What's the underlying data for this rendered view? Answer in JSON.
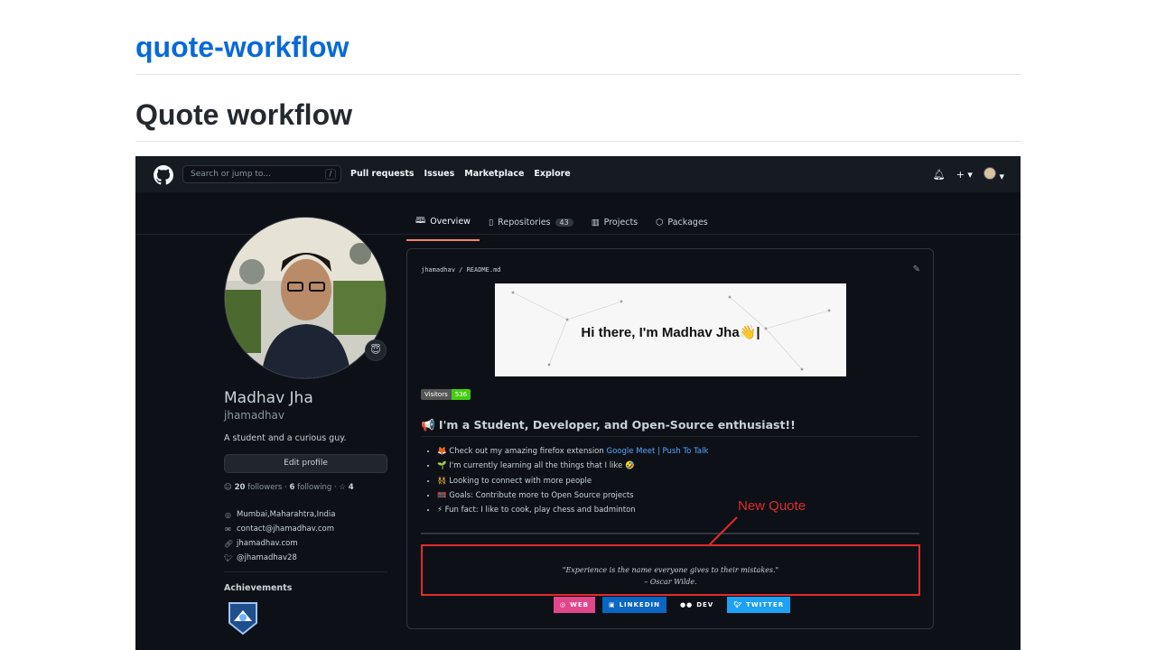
{
  "site": {
    "title": "quote-workflow",
    "page_title": "Quote workflow"
  },
  "topbar": {
    "search_placeholder": "Search or jump to...",
    "search_shortcut": "/",
    "nav": [
      "Pull requests",
      "Issues",
      "Marketplace",
      "Explore"
    ]
  },
  "tabs": [
    {
      "label": "Overview",
      "icon": "book-icon"
    },
    {
      "label": "Repositories",
      "icon": "repo-icon",
      "count": "43"
    },
    {
      "label": "Projects",
      "icon": "project-icon"
    },
    {
      "label": "Packages",
      "icon": "package-icon"
    }
  ],
  "profile": {
    "status_emoji": "😇",
    "name": "Madhav Jha",
    "login": "jhamadhav",
    "bio": "A student and a curious guy.",
    "edit_button": "Edit profile",
    "followers_count": "20",
    "followers_label": "followers",
    "following_count": "6",
    "following_label": "following",
    "stars": "4",
    "location": "Mumbai,Maharahtra,India",
    "email": "contact@jhamadhav.com",
    "website": "jhamadhav.com",
    "twitter": "@jhamadhav28",
    "achievements_title": "Achievements"
  },
  "readme": {
    "breadcrumb": "jhamadhav / README.md",
    "banner_text": "Hi there, I'm Madhav Jha👋|",
    "visitors_label": "Visitors",
    "visitors_count": "536",
    "heading": "📢 I'm a Student, Developer, and Open-Source enthusiast!!",
    "bullet1_prefix": "🦊 Check out my amazing firefox extension ",
    "bullet1_link": "Google Meet | Push To Talk",
    "bullet2": "🌱 I'm currently learning all the things that I like 🤣",
    "bullet3": "👯 Looking to connect with more people",
    "bullet4": "🥅 Goals: Contribute more to Open Source projects",
    "bullet5": "⚡ Fun fact: I like to cook, play chess and badminton",
    "quote_line1": "\"Experience is the name everyone gives to their mistakes.\"",
    "quote_line2": "– Oscar Wilde.",
    "social": [
      "WEB",
      "LINKEDIN",
      "DEV",
      "TWITTER"
    ]
  },
  "annotation": {
    "label": "New Quote",
    "color": "#e02b2b"
  },
  "colors": {
    "link_blue": "#0969da",
    "dark_bg": "#0d1117",
    "tab_accent": "#f78166"
  }
}
